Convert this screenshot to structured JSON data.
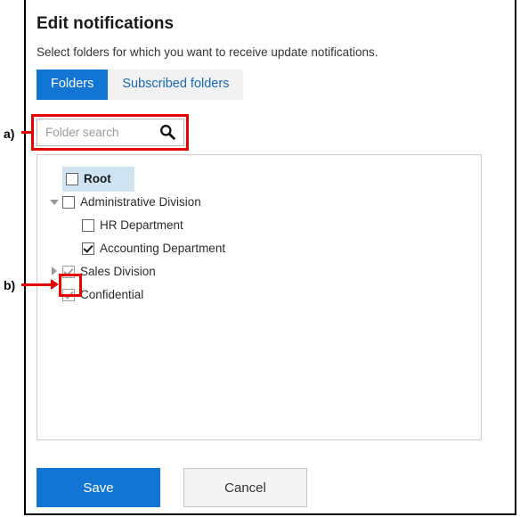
{
  "dialog": {
    "title": "Edit notifications",
    "subtitle": "Select folders for which you want to receive update notifications."
  },
  "tabs": [
    {
      "label": "Folders",
      "active": true
    },
    {
      "label": "Subscribed folders",
      "active": false
    }
  ],
  "search": {
    "value": "",
    "placeholder": "Folder search",
    "icon": "search-icon"
  },
  "tree": {
    "items": [
      {
        "label": "Root",
        "depth": 0,
        "twisty": "none",
        "checked": false,
        "dim": false,
        "bold": true,
        "selected": true
      },
      {
        "label": "Administrative Division",
        "depth": 0,
        "twisty": "expanded",
        "checked": false,
        "dim": false,
        "bold": false,
        "selected": false
      },
      {
        "label": "HR Department",
        "depth": 1,
        "twisty": "none",
        "checked": false,
        "dim": false,
        "bold": false,
        "selected": false
      },
      {
        "label": "Accounting Department",
        "depth": 1,
        "twisty": "none",
        "checked": true,
        "dim": false,
        "bold": false,
        "selected": false
      },
      {
        "label": "Sales Division",
        "depth": 0,
        "twisty": "collapsed",
        "checked": true,
        "dim": true,
        "bold": false,
        "selected": false
      },
      {
        "label": "Confidential",
        "depth": 0,
        "twisty": "none",
        "checked": true,
        "dim": true,
        "bold": false,
        "selected": false
      }
    ]
  },
  "footer": {
    "save_label": "Save",
    "cancel_label": "Cancel"
  },
  "annotations": [
    {
      "id": "a",
      "label": "a)",
      "target": "folder-search-box"
    },
    {
      "id": "b",
      "label": "b)",
      "target": "sales-division-checkbox"
    }
  ],
  "colors": {
    "accent_blue": "#1275d4",
    "tab_inactive_bg": "#f2f2f2",
    "tab_inactive_text": "#1469b5",
    "annotation_red": "#e60000",
    "selection_blue": "#cfe4f2",
    "panel_border": "#cccccc"
  }
}
